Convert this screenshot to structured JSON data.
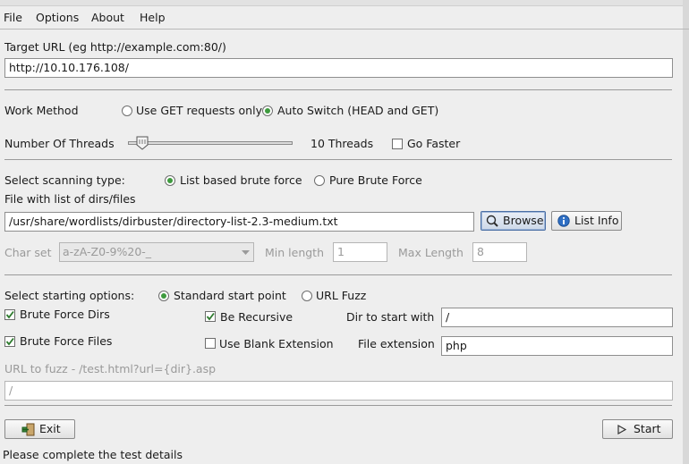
{
  "menu": {
    "items": [
      "File",
      "Options",
      "About",
      "Help"
    ]
  },
  "target": {
    "label": "Target URL (eg http://example.com:80/)",
    "value": "http://10.10.176.108/"
  },
  "work_method": {
    "label": "Work Method",
    "option_get": "Use GET requests only",
    "option_auto": "Auto Switch (HEAD and GET)",
    "selected": "auto"
  },
  "threads": {
    "label": "Number Of Threads",
    "value_text": "10 Threads",
    "level_fraction": 0.1,
    "go_faster_label": "Go Faster",
    "go_faster_checked": false
  },
  "scan_type": {
    "label": "Select scanning type:",
    "option_list": "List based brute force",
    "option_pure": "Pure Brute Force",
    "selected": "list"
  },
  "wordlist": {
    "label": "File with list of dirs/files",
    "value": "/usr/share/wordlists/dirbuster/directory-list-2.3-medium.txt",
    "browse_label": "Browse",
    "list_info_label": "List Info"
  },
  "charset": {
    "label": "Char set",
    "value": "a-zA-Z0-9%20-_",
    "min_label": "Min length",
    "min_value": "1",
    "max_label": "Max Length",
    "max_value": "8"
  },
  "start_options": {
    "label": "Select starting options:",
    "option_standard": "Standard start point",
    "option_fuzz": "URL Fuzz",
    "selected": "standard",
    "brute_dirs_label": "Brute Force Dirs",
    "brute_dirs_checked": true,
    "brute_files_label": "Brute Force Files",
    "brute_files_checked": true,
    "recursive_label": "Be Recursive",
    "recursive_checked": true,
    "blank_ext_label": "Use Blank Extension",
    "blank_ext_checked": false,
    "dir_start_label": "Dir to start with",
    "dir_start_value": "/",
    "file_ext_label": "File extension",
    "file_ext_value": "php"
  },
  "fuzz": {
    "label": "URL to fuzz - /test.html?url={dir}.asp",
    "value": "/"
  },
  "buttons": {
    "exit_label": "Exit",
    "start_label": "Start"
  },
  "status": {
    "text": "Please complete the test details"
  },
  "colors": {
    "radio_selected": "#3e9a3e",
    "focus_border": "#4a6fa5"
  }
}
